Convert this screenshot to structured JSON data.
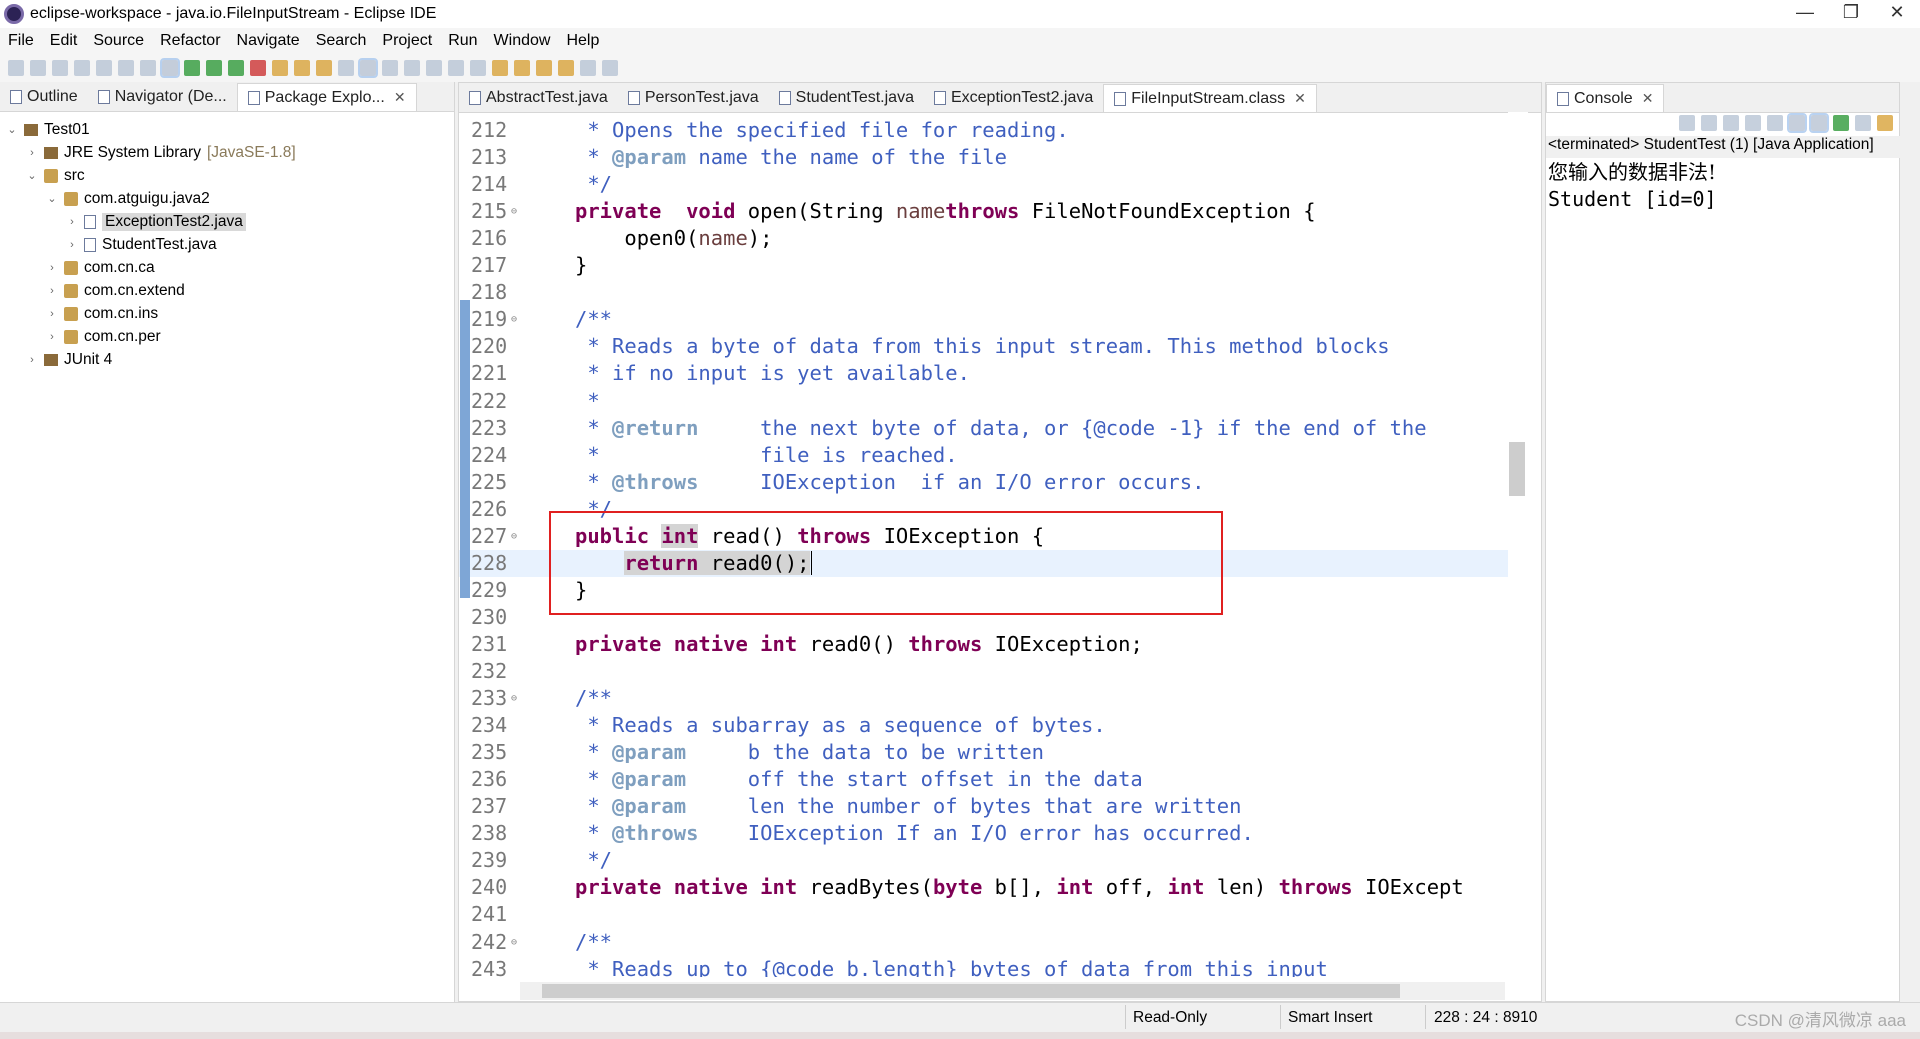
{
  "window": {
    "title": "eclipse-workspace - java.io.FileInputStream - Eclipse IDE"
  },
  "menu": [
    "File",
    "Edit",
    "Source",
    "Refactor",
    "Navigate",
    "Search",
    "Project",
    "Run",
    "Window",
    "Help"
  ],
  "left_tabs": [
    {
      "label": "Outline",
      "icon": "outline-icon"
    },
    {
      "label": "Navigator (De...",
      "icon": "navigator-icon"
    },
    {
      "label": "Package Explo...",
      "icon": "package-explorer-icon",
      "active": true
    }
  ],
  "tree": [
    {
      "label": "Test01",
      "depth": 0,
      "chevron": "v",
      "icon": "project"
    },
    {
      "label": "JRE System Library",
      "suffix": "[JavaSE-1.8]",
      "depth": 1,
      "chevron": ">",
      "icon": "library"
    },
    {
      "label": "src",
      "depth": 1,
      "chevron": "v",
      "icon": "folder"
    },
    {
      "label": "com.atguigu.java2",
      "depth": 2,
      "chevron": "v",
      "icon": "package"
    },
    {
      "label": "ExceptionTest2.java",
      "depth": 3,
      "chevron": ">",
      "icon": "java",
      "selected": true
    },
    {
      "label": "StudentTest.java",
      "depth": 3,
      "chevron": ">",
      "icon": "java"
    },
    {
      "label": "com.cn.ca",
      "depth": 2,
      "chevron": ">",
      "icon": "package"
    },
    {
      "label": "com.cn.extend",
      "depth": 2,
      "chevron": ">",
      "icon": "package"
    },
    {
      "label": "com.cn.ins",
      "depth": 2,
      "chevron": ">",
      "icon": "package"
    },
    {
      "label": "com.cn.per",
      "depth": 2,
      "chevron": ">",
      "icon": "package"
    },
    {
      "label": "JUnit 4",
      "depth": 1,
      "chevron": ">",
      "icon": "library"
    }
  ],
  "editor_tabs": [
    {
      "label": "AbstractTest.java"
    },
    {
      "label": "PersonTest.java"
    },
    {
      "label": "StudentTest.java"
    },
    {
      "label": "ExceptionTest2.java"
    },
    {
      "label": "FileInputStream.class",
      "active": true
    }
  ],
  "code": [
    {
      "n": "212",
      "s": [
        [
          "c",
          " * Opens the specified file for reading."
        ]
      ]
    },
    {
      "n": "213",
      "s": [
        [
          "c",
          " * "
        ],
        [
          "t",
          "@param"
        ],
        [
          "c",
          " name the name of the file"
        ]
      ]
    },
    {
      "n": "214",
      "s": [
        [
          "c",
          " */"
        ]
      ]
    },
    {
      "n": "215",
      "fold": true,
      "s": [
        [
          "k",
          "private"
        ],
        [
          "",
          "  "
        ],
        [
          "k",
          "void"
        ],
        [
          "",
          " open(String "
        ],
        [
          "p",
          "name"
        ],
        [
          ") "
        ],
        [
          "k",
          "throws"
        ],
        [
          "",
          " FileNotFoundException {"
        ]
      ]
    },
    {
      "n": "216",
      "s": [
        [
          "",
          "    open0("
        ],
        [
          "p",
          "name"
        ],
        [
          "",
          ");"
        ]
      ]
    },
    {
      "n": "217",
      "s": [
        [
          "",
          "}"
        ]
      ]
    },
    {
      "n": "218",
      "s": []
    },
    {
      "n": "219",
      "fold": true,
      "s": [
        [
          "c",
          "/**"
        ]
      ]
    },
    {
      "n": "220",
      "s": [
        [
          "c",
          " * Reads a byte of data from this input stream. This method blocks"
        ]
      ]
    },
    {
      "n": "221",
      "s": [
        [
          "c",
          " * if no input is yet available."
        ]
      ]
    },
    {
      "n": "222",
      "s": [
        [
          "c",
          " *"
        ]
      ]
    },
    {
      "n": "223",
      "s": [
        [
          "c",
          " * "
        ],
        [
          "t",
          "@return"
        ],
        [
          "c",
          "     the next byte of data, or {@code -1} if the end of the"
        ]
      ]
    },
    {
      "n": "224",
      "s": [
        [
          "c",
          " *             file is reached."
        ]
      ]
    },
    {
      "n": "225",
      "s": [
        [
          "c",
          " * "
        ],
        [
          "t",
          "@throws"
        ],
        [
          "c",
          "     IOException  if an I/O error occurs."
        ]
      ]
    },
    {
      "n": "226",
      "s": [
        [
          "c",
          " */"
        ]
      ]
    },
    {
      "n": "227",
      "fold": true,
      "s": [
        [
          "k",
          "public"
        ],
        [
          "",
          " "
        ],
        [
          "k hl",
          "int"
        ],
        [
          "",
          " read() "
        ],
        [
          "k",
          "throws"
        ],
        [
          "",
          " IOException {"
        ]
      ]
    },
    {
      "n": "228",
      "cur": true,
      "s": [
        [
          "",
          "    "
        ],
        [
          "k hl",
          "return"
        ],
        [
          "hl",
          " read0();"
        ]
      ]
    },
    {
      "n": "229",
      "s": [
        [
          "",
          "}"
        ]
      ]
    },
    {
      "n": "230",
      "s": []
    },
    {
      "n": "231",
      "s": [
        [
          "k",
          "private"
        ],
        [
          "",
          " "
        ],
        [
          "k",
          "native"
        ],
        [
          "",
          " "
        ],
        [
          "k",
          "int"
        ],
        [
          "",
          " read0() "
        ],
        [
          "k",
          "throws"
        ],
        [
          "",
          " IOException;"
        ]
      ]
    },
    {
      "n": "232",
      "s": []
    },
    {
      "n": "233",
      "fold": true,
      "s": [
        [
          "c",
          "/**"
        ]
      ]
    },
    {
      "n": "234",
      "s": [
        [
          "c",
          " * Reads a subarray as a sequence of bytes."
        ]
      ]
    },
    {
      "n": "235",
      "s": [
        [
          "c",
          " * "
        ],
        [
          "t",
          "@param"
        ],
        [
          "c",
          "     b the data to be written"
        ]
      ]
    },
    {
      "n": "236",
      "s": [
        [
          "c",
          " * "
        ],
        [
          "t",
          "@param"
        ],
        [
          "c",
          "     off the start offset in the data"
        ]
      ]
    },
    {
      "n": "237",
      "s": [
        [
          "c",
          " * "
        ],
        [
          "t",
          "@param"
        ],
        [
          "c",
          "     len the number of bytes that are written"
        ]
      ]
    },
    {
      "n": "238",
      "s": [
        [
          "c",
          " * "
        ],
        [
          "t",
          "@throws"
        ],
        [
          "c",
          "    IOException If an I/O error has occurred."
        ]
      ]
    },
    {
      "n": "239",
      "s": [
        [
          "c",
          " */"
        ]
      ]
    },
    {
      "n": "240",
      "s": [
        [
          "k",
          "private"
        ],
        [
          "",
          " "
        ],
        [
          "k",
          "native"
        ],
        [
          "",
          " "
        ],
        [
          "k",
          "int"
        ],
        [
          "",
          " readBytes("
        ],
        [
          "k",
          "byte"
        ],
        [
          "",
          " b[], "
        ],
        [
          "k",
          "int"
        ],
        [
          "",
          " off, "
        ],
        [
          "k",
          "int"
        ],
        [
          "",
          " len) "
        ],
        [
          "k",
          "throws"
        ],
        [
          "",
          " IOExcept"
        ]
      ]
    },
    {
      "n": "241",
      "s": []
    },
    {
      "n": "242",
      "fold": true,
      "s": [
        [
          "c",
          "/**"
        ]
      ]
    },
    {
      "n": "243",
      "s": [
        [
          "c",
          " * Reads up to {@code b.length} bytes of data from this input"
        ]
      ]
    }
  ],
  "console": {
    "tab": "Console",
    "header": "<terminated> StudentTest (1) [Java Application]",
    "output": [
      "您输入的数据非法!",
      "Student [id=0]"
    ]
  },
  "status": {
    "mode": "Read-Only",
    "insert": "Smart Insert",
    "position": "228 : 24 : 8910"
  },
  "watermark": "CSDN @清风微凉 aaa",
  "colors": {
    "keyword": "#7f0055",
    "comment": "#3f5fbf",
    "javadoc_tag": "#7f9fbf",
    "highlight_box": "#e02020"
  }
}
